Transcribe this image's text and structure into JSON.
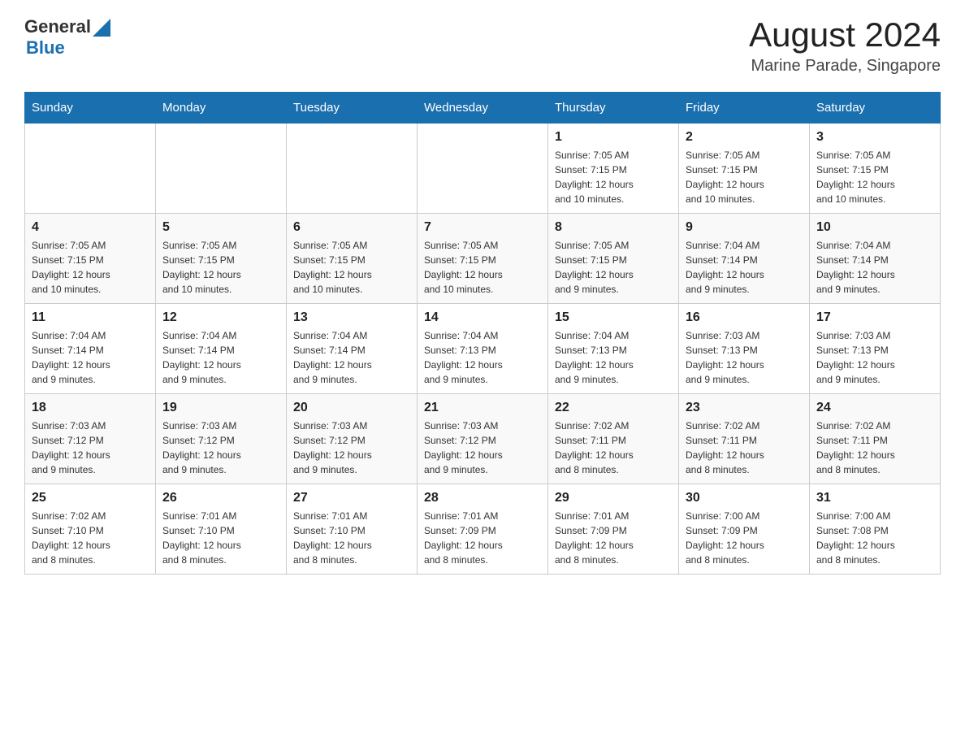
{
  "header": {
    "logo_general": "General",
    "logo_blue": "Blue",
    "month": "August 2024",
    "location": "Marine Parade, Singapore"
  },
  "days_of_week": [
    "Sunday",
    "Monday",
    "Tuesday",
    "Wednesday",
    "Thursday",
    "Friday",
    "Saturday"
  ],
  "weeks": [
    {
      "cells": [
        {
          "day": "",
          "info": ""
        },
        {
          "day": "",
          "info": ""
        },
        {
          "day": "",
          "info": ""
        },
        {
          "day": "",
          "info": ""
        },
        {
          "day": "1",
          "info": "Sunrise: 7:05 AM\nSunset: 7:15 PM\nDaylight: 12 hours\nand 10 minutes."
        },
        {
          "day": "2",
          "info": "Sunrise: 7:05 AM\nSunset: 7:15 PM\nDaylight: 12 hours\nand 10 minutes."
        },
        {
          "day": "3",
          "info": "Sunrise: 7:05 AM\nSunset: 7:15 PM\nDaylight: 12 hours\nand 10 minutes."
        }
      ]
    },
    {
      "cells": [
        {
          "day": "4",
          "info": "Sunrise: 7:05 AM\nSunset: 7:15 PM\nDaylight: 12 hours\nand 10 minutes."
        },
        {
          "day": "5",
          "info": "Sunrise: 7:05 AM\nSunset: 7:15 PM\nDaylight: 12 hours\nand 10 minutes."
        },
        {
          "day": "6",
          "info": "Sunrise: 7:05 AM\nSunset: 7:15 PM\nDaylight: 12 hours\nand 10 minutes."
        },
        {
          "day": "7",
          "info": "Sunrise: 7:05 AM\nSunset: 7:15 PM\nDaylight: 12 hours\nand 10 minutes."
        },
        {
          "day": "8",
          "info": "Sunrise: 7:05 AM\nSunset: 7:15 PM\nDaylight: 12 hours\nand 9 minutes."
        },
        {
          "day": "9",
          "info": "Sunrise: 7:04 AM\nSunset: 7:14 PM\nDaylight: 12 hours\nand 9 minutes."
        },
        {
          "day": "10",
          "info": "Sunrise: 7:04 AM\nSunset: 7:14 PM\nDaylight: 12 hours\nand 9 minutes."
        }
      ]
    },
    {
      "cells": [
        {
          "day": "11",
          "info": "Sunrise: 7:04 AM\nSunset: 7:14 PM\nDaylight: 12 hours\nand 9 minutes."
        },
        {
          "day": "12",
          "info": "Sunrise: 7:04 AM\nSunset: 7:14 PM\nDaylight: 12 hours\nand 9 minutes."
        },
        {
          "day": "13",
          "info": "Sunrise: 7:04 AM\nSunset: 7:14 PM\nDaylight: 12 hours\nand 9 minutes."
        },
        {
          "day": "14",
          "info": "Sunrise: 7:04 AM\nSunset: 7:13 PM\nDaylight: 12 hours\nand 9 minutes."
        },
        {
          "day": "15",
          "info": "Sunrise: 7:04 AM\nSunset: 7:13 PM\nDaylight: 12 hours\nand 9 minutes."
        },
        {
          "day": "16",
          "info": "Sunrise: 7:03 AM\nSunset: 7:13 PM\nDaylight: 12 hours\nand 9 minutes."
        },
        {
          "day": "17",
          "info": "Sunrise: 7:03 AM\nSunset: 7:13 PM\nDaylight: 12 hours\nand 9 minutes."
        }
      ]
    },
    {
      "cells": [
        {
          "day": "18",
          "info": "Sunrise: 7:03 AM\nSunset: 7:12 PM\nDaylight: 12 hours\nand 9 minutes."
        },
        {
          "day": "19",
          "info": "Sunrise: 7:03 AM\nSunset: 7:12 PM\nDaylight: 12 hours\nand 9 minutes."
        },
        {
          "day": "20",
          "info": "Sunrise: 7:03 AM\nSunset: 7:12 PM\nDaylight: 12 hours\nand 9 minutes."
        },
        {
          "day": "21",
          "info": "Sunrise: 7:03 AM\nSunset: 7:12 PM\nDaylight: 12 hours\nand 9 minutes."
        },
        {
          "day": "22",
          "info": "Sunrise: 7:02 AM\nSunset: 7:11 PM\nDaylight: 12 hours\nand 8 minutes."
        },
        {
          "day": "23",
          "info": "Sunrise: 7:02 AM\nSunset: 7:11 PM\nDaylight: 12 hours\nand 8 minutes."
        },
        {
          "day": "24",
          "info": "Sunrise: 7:02 AM\nSunset: 7:11 PM\nDaylight: 12 hours\nand 8 minutes."
        }
      ]
    },
    {
      "cells": [
        {
          "day": "25",
          "info": "Sunrise: 7:02 AM\nSunset: 7:10 PM\nDaylight: 12 hours\nand 8 minutes."
        },
        {
          "day": "26",
          "info": "Sunrise: 7:01 AM\nSunset: 7:10 PM\nDaylight: 12 hours\nand 8 minutes."
        },
        {
          "day": "27",
          "info": "Sunrise: 7:01 AM\nSunset: 7:10 PM\nDaylight: 12 hours\nand 8 minutes."
        },
        {
          "day": "28",
          "info": "Sunrise: 7:01 AM\nSunset: 7:09 PM\nDaylight: 12 hours\nand 8 minutes."
        },
        {
          "day": "29",
          "info": "Sunrise: 7:01 AM\nSunset: 7:09 PM\nDaylight: 12 hours\nand 8 minutes."
        },
        {
          "day": "30",
          "info": "Sunrise: 7:00 AM\nSunset: 7:09 PM\nDaylight: 12 hours\nand 8 minutes."
        },
        {
          "day": "31",
          "info": "Sunrise: 7:00 AM\nSunset: 7:08 PM\nDaylight: 12 hours\nand 8 minutes."
        }
      ]
    }
  ]
}
